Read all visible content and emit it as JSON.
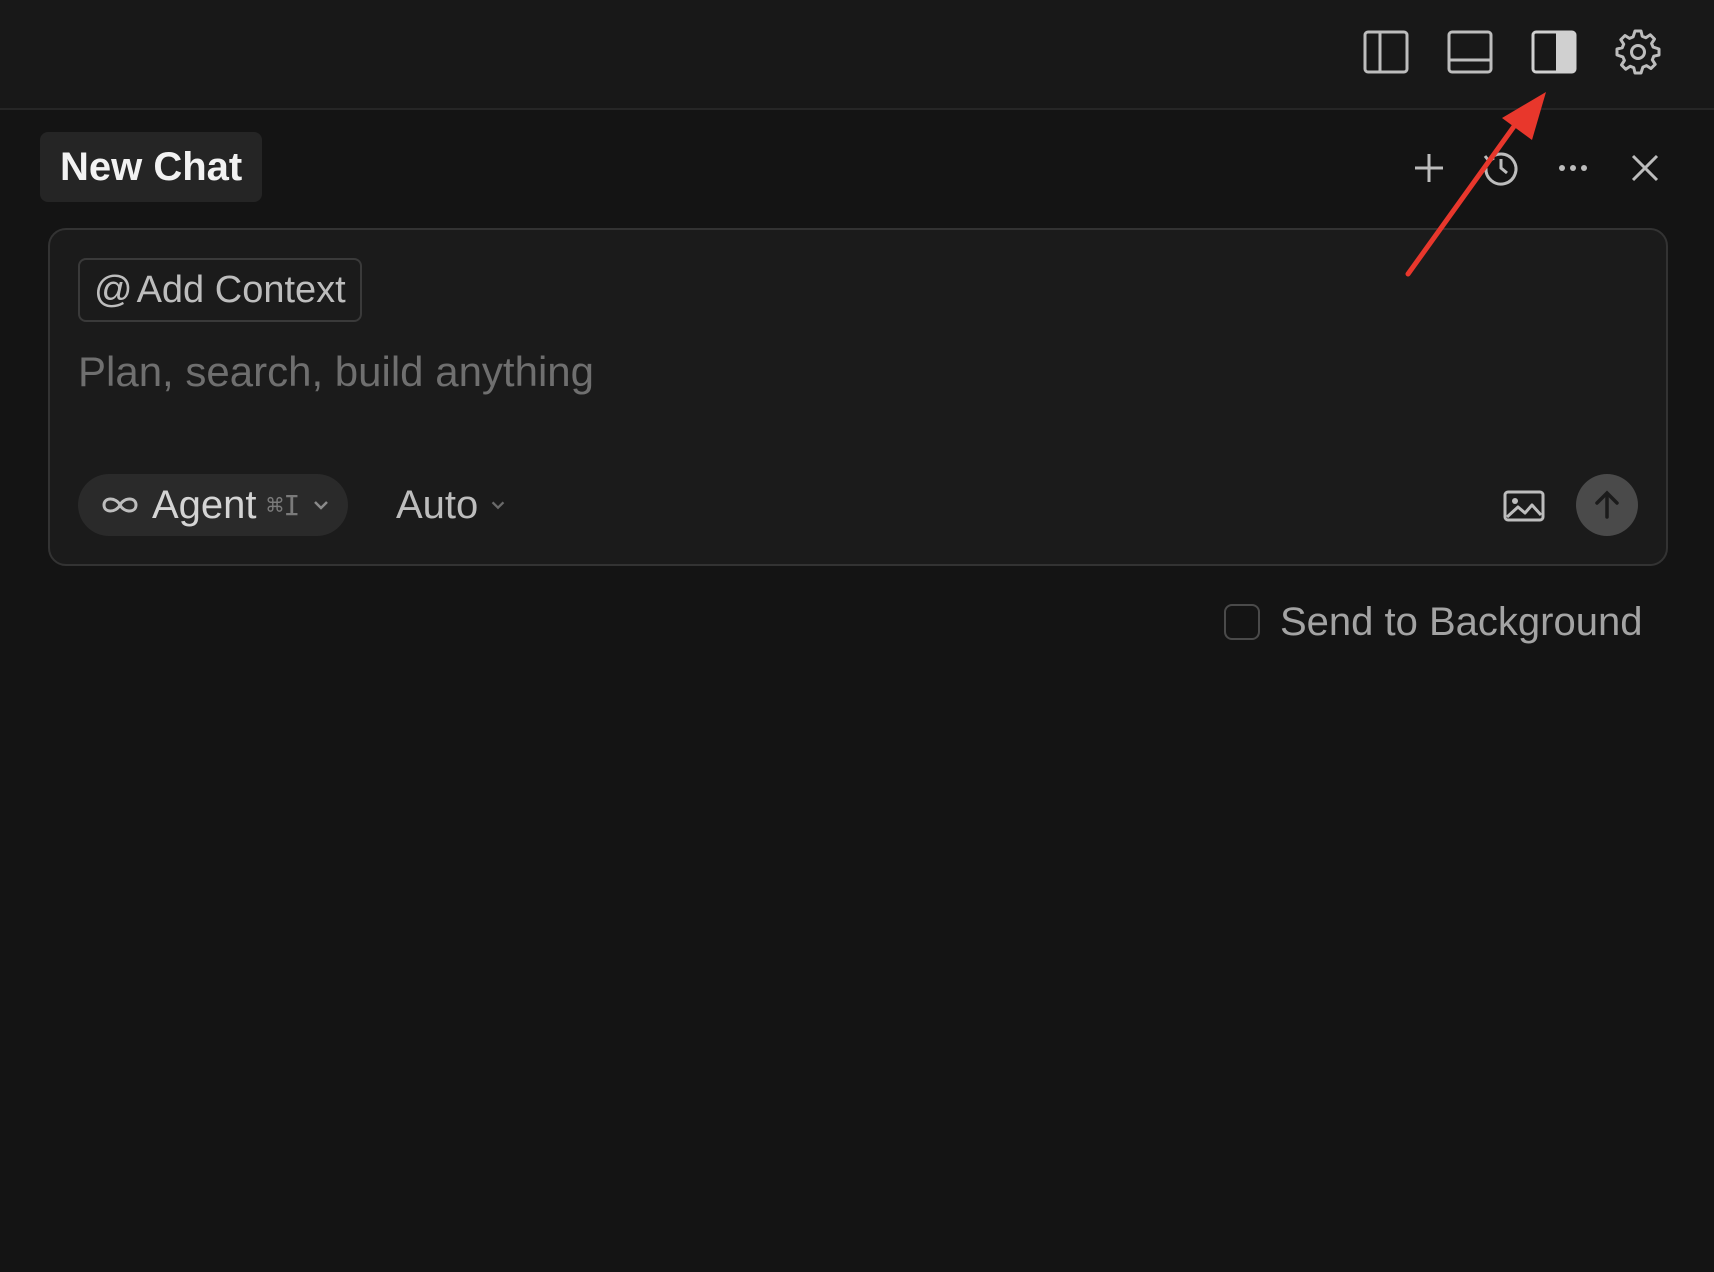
{
  "topbar": {
    "icons": [
      {
        "name": "toggle-primary-sidebar-icon"
      },
      {
        "name": "toggle-panel-icon"
      },
      {
        "name": "toggle-secondary-sidebar-icon"
      },
      {
        "name": "gear-icon"
      }
    ]
  },
  "chat": {
    "title": "New Chat",
    "header_icons": [
      "plus-icon",
      "history-icon",
      "more-icon",
      "close-icon"
    ]
  },
  "composer": {
    "add_context_at": "@",
    "add_context_label": "Add Context",
    "placeholder": "Plan, search, build anything",
    "mode_label": "Agent",
    "mode_shortcut": "⌘I",
    "model_label": "Auto"
  },
  "send_to_background": {
    "label": "Send to Background",
    "checked": false
  },
  "colors": {
    "background": "#141414",
    "topbar": "#181818",
    "annotation_arrow": "#e8372c"
  }
}
